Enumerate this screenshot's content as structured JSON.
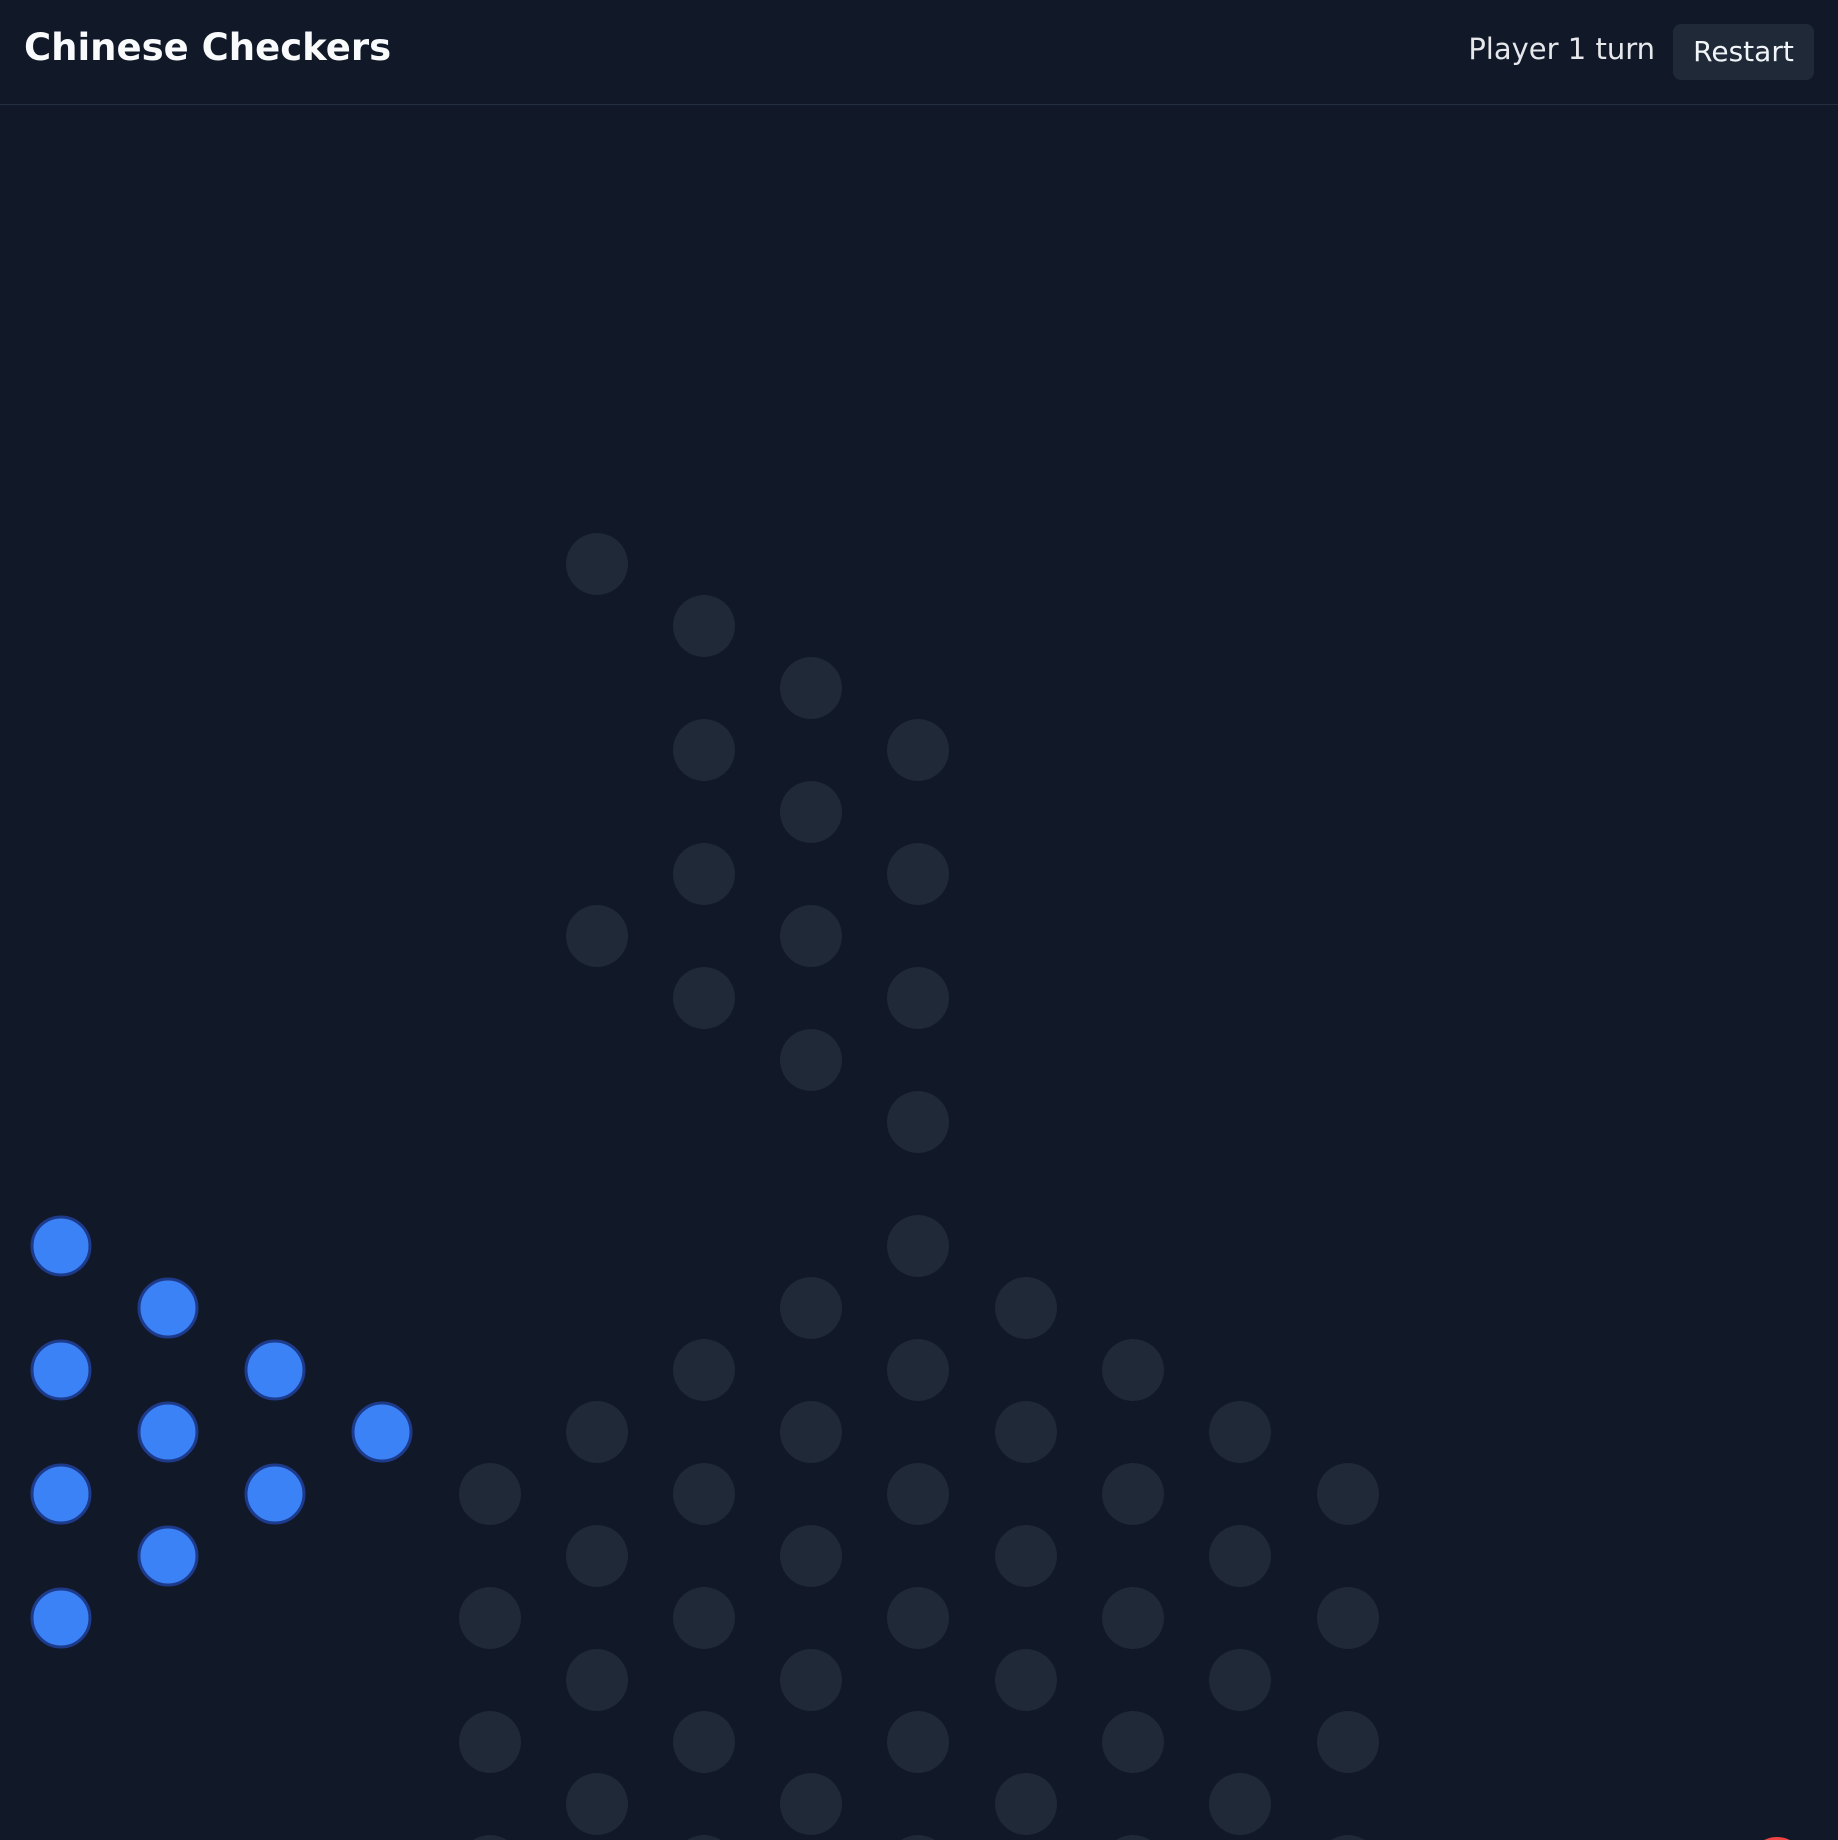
{
  "header": {
    "title": "Chinese Checkers",
    "status": "Player 1 turn",
    "restart_label": "Restart"
  },
  "colors": {
    "background": "#111827",
    "empty_hole": "#1f2937",
    "player_1_piece": "#3b82f6",
    "player_2_piece": "#ef4444"
  },
  "board": {
    "player_1_pieces": 10,
    "visible_opponent_piece_color": "red"
  }
}
